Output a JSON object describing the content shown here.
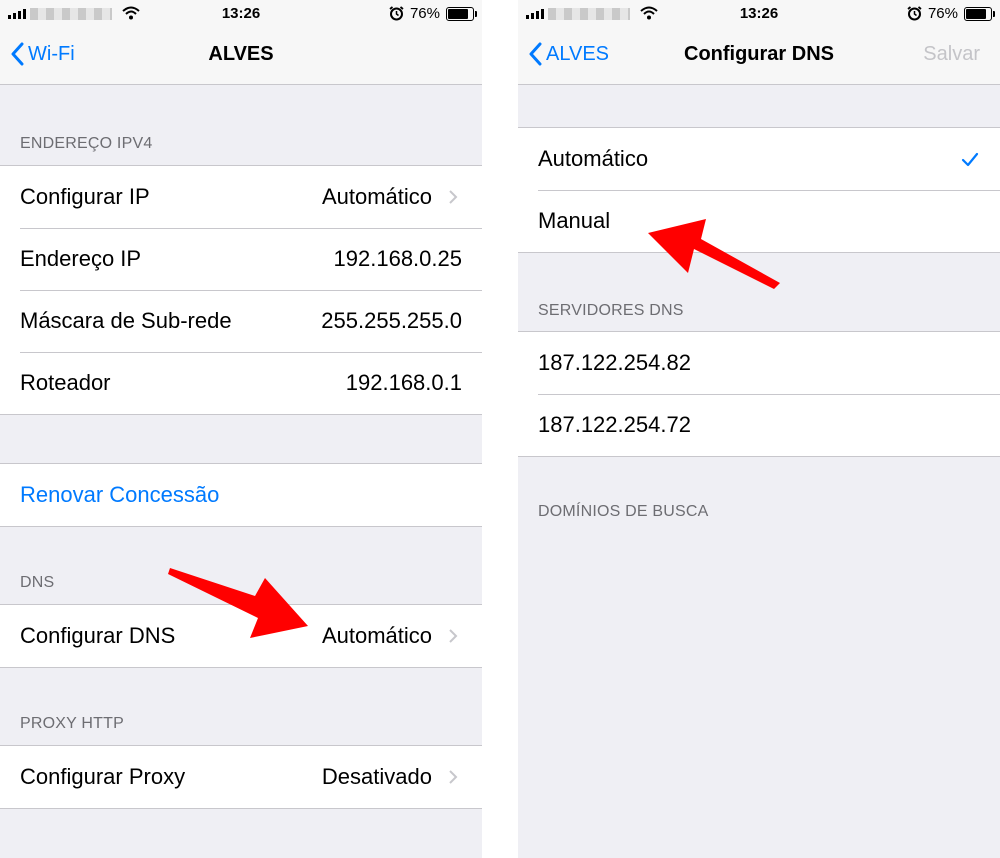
{
  "left_screen": {
    "status": {
      "time": "13:26",
      "battery": "76%",
      "battery_level": 0.76
    },
    "nav": {
      "back_label": "Wi-Fi",
      "title": "ALVES"
    },
    "ipv4": {
      "header": "ENDEREÇO IPV4",
      "rows": [
        {
          "label": "Configurar IP",
          "value": "Automático"
        },
        {
          "label": "Endereço IP",
          "value": "192.168.0.25"
        },
        {
          "label": "Máscara de Sub-rede",
          "value": "255.255.255.0"
        },
        {
          "label": "Roteador",
          "value": "192.168.0.1"
        }
      ]
    },
    "renew_label": "Renovar Concessão",
    "dns": {
      "header": "DNS",
      "label": "Configurar DNS",
      "value": "Automático"
    },
    "proxy": {
      "header": "PROXY HTTP",
      "label": "Configurar Proxy",
      "value": "Desativado"
    }
  },
  "right_screen": {
    "status": {
      "time": "13:26",
      "battery": "76%",
      "battery_level": 0.76
    },
    "nav": {
      "back_label": "ALVES",
      "title": "Configurar DNS",
      "save_label": "Salvar"
    },
    "options": [
      {
        "label": "Automático",
        "selected": true
      },
      {
        "label": "Manual",
        "selected": false
      }
    ],
    "servers": {
      "header": "SERVIDORES DNS",
      "items": [
        "187.122.254.82",
        "187.122.254.72"
      ]
    },
    "search_domains_header": "DOMÍNIOS DE BUSCA"
  },
  "colors": {
    "accent": "#007aff",
    "annotation_arrow": "#ff0000",
    "background": "#efeff4"
  },
  "icons": [
    "chevron-left-icon",
    "chevron-right-icon",
    "checkmark-icon",
    "wifi-icon",
    "alarm-icon",
    "battery-icon",
    "signal-icon"
  ]
}
